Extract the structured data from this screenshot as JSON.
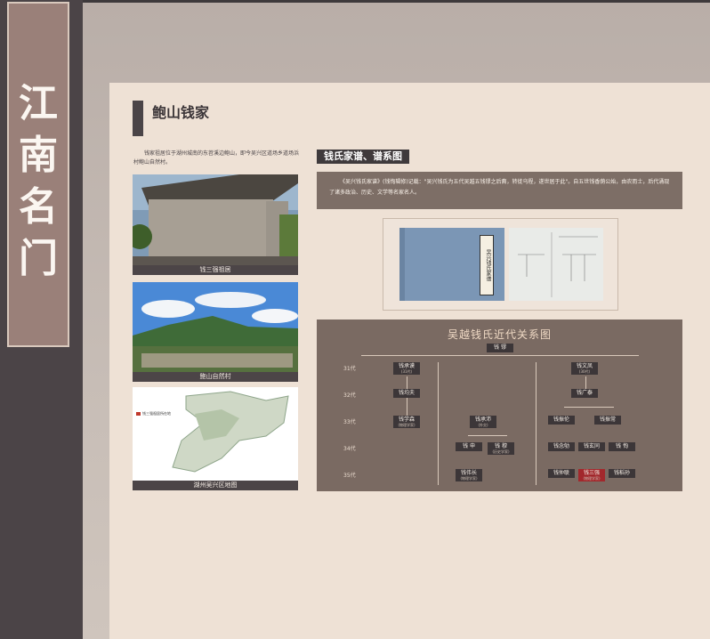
{
  "sidebar": {
    "title_chars": [
      "江",
      "南",
      "名",
      "门"
    ]
  },
  "board": {
    "heading": "鲍山钱家",
    "intro": "钱家祖居位于湖州城南的东苕溪边鲍山，即今吴兴区道场乡道场浜村鲍山自然村。",
    "photos": [
      {
        "caption": "钱三强祖居"
      },
      {
        "caption": "鲍山自然村"
      },
      {
        "caption": "湖州吴兴区地图",
        "map_legend": "钱三强祖居所在地"
      }
    ],
    "section_tab": "钱氏家谱、谱系图",
    "quote": "《吴兴钱氏家谱》(钱恂辑修)记载：\"吴兴钱氏为五代吴越五钱镠之后裔，转徙乌程，遂世居于此\"。自五世钱香荫公始，由农而士，后代涌现了诸多政治、历史、文学等名家名人。",
    "book_cover_text": "吴兴钱氏家谱"
  },
  "chart": {
    "title": "吴越钱氏近代关系图",
    "root": "钱 镠",
    "generations": [
      "31代",
      "32代",
      "33代",
      "34代",
      "35代"
    ],
    "nodes": {
      "g31a": {
        "name": "钱承谟",
        "note": "(31代)"
      },
      "g31b": {
        "name": "钱文凤",
        "note": "(30代)"
      },
      "g32a": {
        "name": "钱均夫"
      },
      "g32b": {
        "name": "钱广泰"
      },
      "g33a": {
        "name": "钱学森",
        "note": "(物理学家)"
      },
      "g33b": {
        "name": "钱承沛",
        "note": "(外交)"
      },
      "g33c": {
        "name": "钱振伦"
      },
      "g33d": {
        "name": "钱振常"
      },
      "g34a": {
        "name": "钱 申"
      },
      "g34b": {
        "name": "钱 穆",
        "note": "(历史学家)"
      },
      "g34c": {
        "name": "钱念劬"
      },
      "g34d": {
        "name": "钱玄同"
      },
      "g34e": {
        "name": "钱 恂"
      },
      "g35a": {
        "name": "钱伟长",
        "note": "(物理学家)"
      },
      "g35b": {
        "name": "钱仲联"
      },
      "g35c": {
        "name": "钱三强",
        "note": "(物理学家)"
      },
      "g35d": {
        "name": "钱稻孙"
      }
    }
  }
}
